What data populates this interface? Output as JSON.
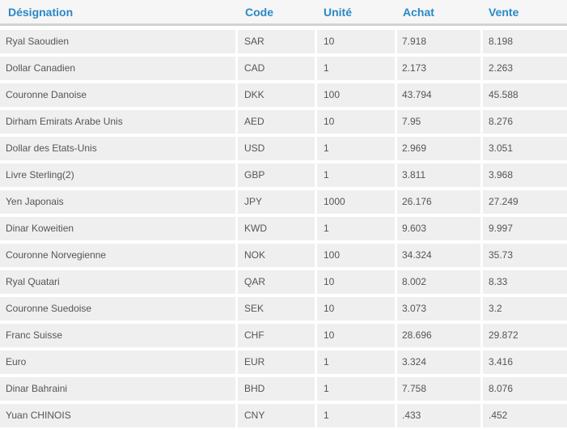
{
  "headers": {
    "designation": "Désignation",
    "code": "Code",
    "unite": "Unité",
    "achat": "Achat",
    "vente": "Vente"
  },
  "colors": {
    "header_text": "#2a88c6",
    "cell_bg": "#efefef",
    "cell_text": "#555555"
  },
  "rows": [
    {
      "designation": "Ryal Saoudien",
      "code": "SAR",
      "unite": "10",
      "achat": "7.918",
      "vente": "8.198"
    },
    {
      "designation": "Dollar Canadien",
      "code": "CAD",
      "unite": "1",
      "achat": "2.173",
      "vente": "2.263"
    },
    {
      "designation": "Couronne Danoise",
      "code": "DKK",
      "unite": "100",
      "achat": "43.794",
      "vente": "45.588"
    },
    {
      "designation": "Dirham Emirats Arabe Unis",
      "code": "AED",
      "unite": "10",
      "achat": "7.95",
      "vente": "8.276"
    },
    {
      "designation": "Dollar des Etats-Unis",
      "code": "USD",
      "unite": "1",
      "achat": "2.969",
      "vente": "3.051"
    },
    {
      "designation": "Livre Sterling(2)",
      "code": "GBP",
      "unite": "1",
      "achat": "3.811",
      "vente": "3.968"
    },
    {
      "designation": "Yen Japonais",
      "code": "JPY",
      "unite": "1000",
      "achat": "26.176",
      "vente": "27.249"
    },
    {
      "designation": "Dinar Koweitien",
      "code": "KWD",
      "unite": "1",
      "achat": "9.603",
      "vente": "9.997"
    },
    {
      "designation": "Couronne Norvegienne",
      "code": "NOK",
      "unite": "100",
      "achat": "34.324",
      "vente": "35.73"
    },
    {
      "designation": "Ryal Quatari",
      "code": "QAR",
      "unite": "10",
      "achat": "8.002",
      "vente": "8.33"
    },
    {
      "designation": "Couronne Suedoise",
      "code": "SEK",
      "unite": "10",
      "achat": "3.073",
      "vente": "3.2"
    },
    {
      "designation": "Franc Suisse",
      "code": "CHF",
      "unite": "10",
      "achat": "28.696",
      "vente": "29.872"
    },
    {
      "designation": "Euro",
      "code": "EUR",
      "unite": "1",
      "achat": "3.324",
      "vente": "3.416"
    },
    {
      "designation": "Dinar Bahraini",
      "code": "BHD",
      "unite": "1",
      "achat": "7.758",
      "vente": "8.076"
    },
    {
      "designation": "Yuan CHINOIS",
      "code": "CNY",
      "unite": "1",
      "achat": ".433",
      "vente": ".452"
    }
  ]
}
